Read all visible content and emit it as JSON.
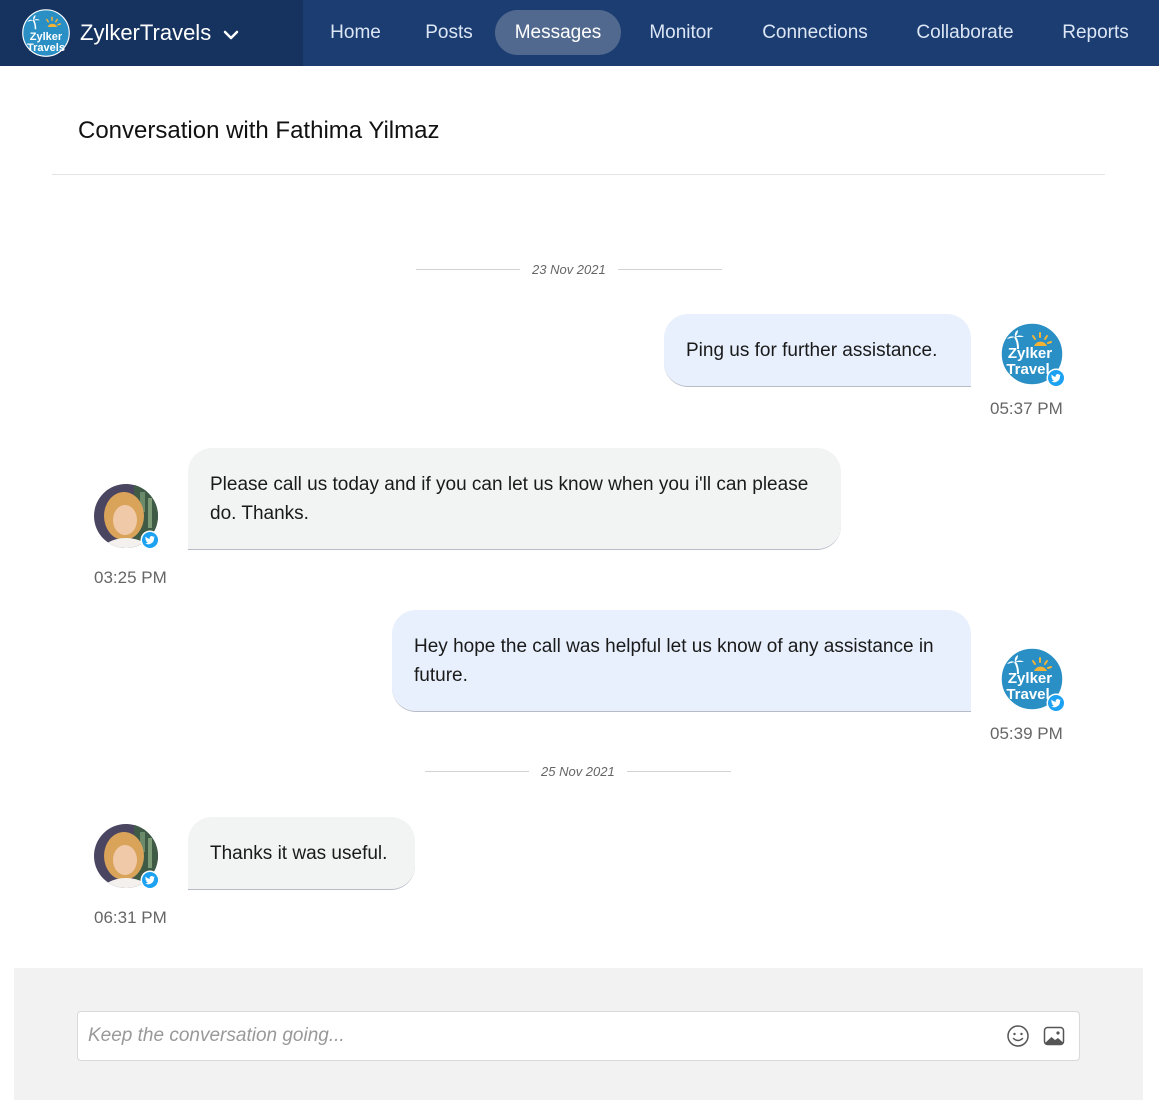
{
  "brand": {
    "logo_text_line1": "Zylker",
    "logo_text_line2": "Travels",
    "name": "ZylkerTravels"
  },
  "nav": {
    "items": [
      {
        "label": "Home"
      },
      {
        "label": "Posts"
      },
      {
        "label": "Messages",
        "active": true
      },
      {
        "label": "Monitor"
      },
      {
        "label": "Connections"
      },
      {
        "label": "Collaborate"
      },
      {
        "label": "Reports"
      }
    ]
  },
  "conversation": {
    "title": "Conversation with Fathima Yilmaz",
    "date_1": "23 Nov 2021",
    "date_2": "25 Nov 2021",
    "messages": [
      {
        "direction": "outgoing",
        "text": "Ping us for further assistance.",
        "time": "05:37 PM",
        "network": "twitter-icon"
      },
      {
        "direction": "incoming",
        "text": "Please call us today and if you can let us know when you i'll can please do. Thanks.",
        "time": "03:25 PM",
        "network": "twitter-icon"
      },
      {
        "direction": "outgoing",
        "text": "Hey hope the call was helpful let us know of any assistance in future.",
        "time": "05:39 PM",
        "network": "twitter-icon"
      },
      {
        "direction": "incoming",
        "text": "Thanks it was useful.",
        "time": "06:31 PM",
        "network": "twitter-icon"
      }
    ]
  },
  "composer": {
    "placeholder": "Keep the conversation going...",
    "value": ""
  },
  "colors": {
    "topbar": "#1b3d72",
    "brand_bg": "#16335f",
    "nav_active": "#52698f",
    "outgoing_bubble": "#e8f0fd",
    "incoming_bubble": "#f2f3f3",
    "twitter": "#1da1f2",
    "composer_area": "#f2f2f2"
  }
}
